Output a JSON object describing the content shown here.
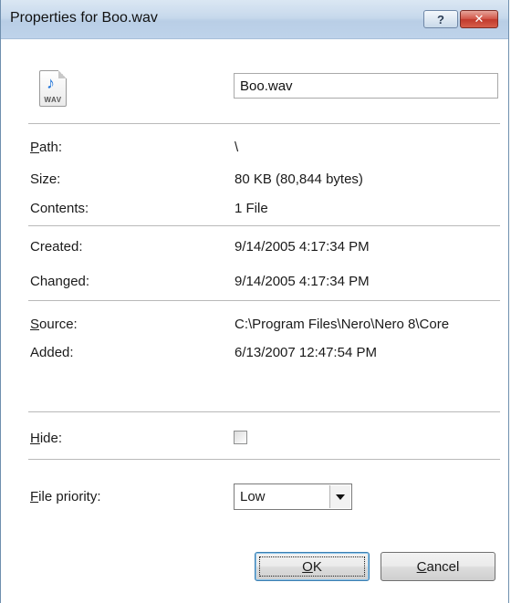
{
  "window": {
    "title": "Properties for Boo.wav",
    "help_glyph": "?",
    "close_glyph": "✕"
  },
  "file": {
    "icon": "wav-audio-file-icon",
    "icon_note": "♪",
    "icon_label": "WAV",
    "name": "Boo.wav"
  },
  "info": {
    "path_label_first": "P",
    "path_label_rest": "ath:",
    "path_value": "\\",
    "size_label": "Size:",
    "size_value": "80 KB (80,844 bytes)",
    "contents_label": "Contents:",
    "contents_value": "1 File",
    "created_label": "Created:",
    "created_value": "9/14/2005 4:17:34 PM",
    "changed_label": "Changed:",
    "changed_value": "9/14/2005 4:17:34 PM",
    "source_label_first": "S",
    "source_label_rest": "ource:",
    "source_value": "C:\\Program Files\\Nero\\Nero 8\\Core",
    "added_label": "Added:",
    "added_value": "6/13/2007 12:47:54 PM"
  },
  "options": {
    "hide_label_first": "H",
    "hide_label_rest": "ide:",
    "hide_checked": false,
    "priority_label_first": "F",
    "priority_label_rest": "ile priority:",
    "priority_value": "Low"
  },
  "buttons": {
    "ok_first": "O",
    "ok_rest": "K",
    "cancel_first": "C",
    "cancel_rest": "ancel"
  }
}
